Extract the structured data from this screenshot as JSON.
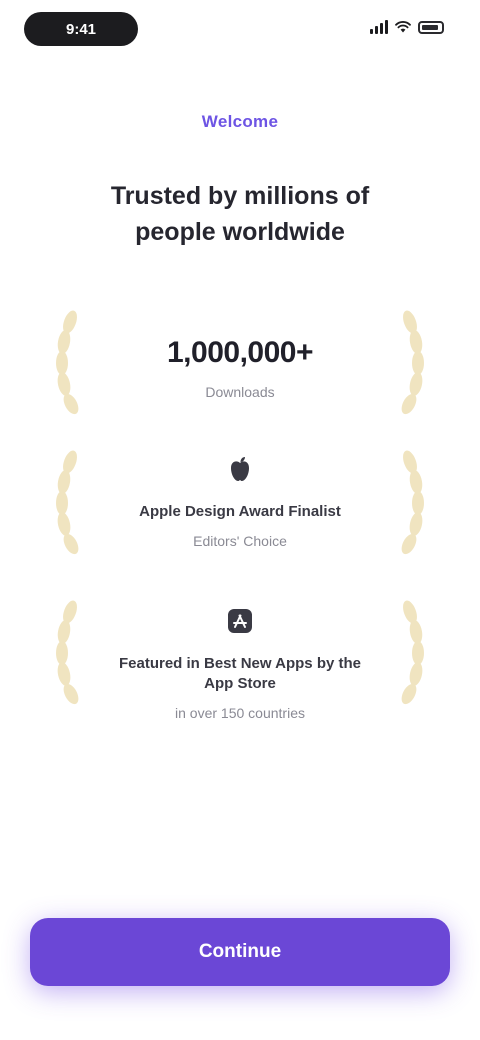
{
  "status": {
    "time": "9:41"
  },
  "header": {
    "eyebrow": "Welcome",
    "headline": "Trusted by millions of people worldwide"
  },
  "stats": {
    "rating": {
      "value": "1,000,000+",
      "label": "Downloads"
    },
    "award_1": {
      "icon": "apple-logo-icon",
      "title": "Apple Design Award Finalist",
      "sub": "Editors' Choice"
    },
    "award_2": {
      "icon": "app-store-icon",
      "title": "Featured in Best New Apps by the App Store",
      "sub": "in over 150 countries"
    }
  },
  "cta": {
    "label": "Continue"
  },
  "colors": {
    "accent": "#6b47d6",
    "eyebrow": "#6d54e4",
    "laurel": "#e9d9a6"
  }
}
